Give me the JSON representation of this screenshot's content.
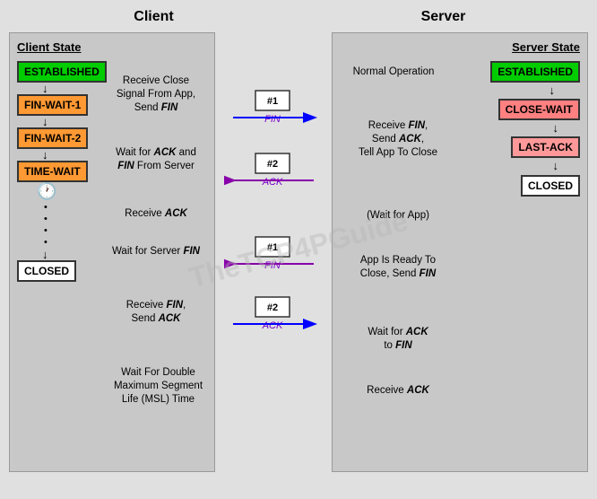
{
  "title": {
    "client": "Client",
    "server": "Server"
  },
  "client": {
    "section_title": "Client State",
    "states": {
      "established": "ESTABLISHED",
      "fin_wait_1": "FIN-WAIT-1",
      "fin_wait_2": "FIN-WAIT-2",
      "time_wait": "TIME-WAIT",
      "closed": "CLOSED"
    },
    "descriptions": {
      "d1": "Receive Close Signal From App, Send FIN",
      "d2": "Wait for ACK and FIN From Server",
      "d3": "Receive ACK",
      "d4": "Wait for Server FIN",
      "d5": "Receive FIN, Send ACK",
      "d6": "Wait For Double Maximum Segment Life (MSL) Time"
    }
  },
  "server": {
    "section_title": "Server State",
    "states": {
      "established": "ESTABLISHED",
      "close_wait": "CLOSE-WAIT",
      "last_ack": "LAST-ACK",
      "closed": "CLOSED"
    },
    "descriptions": {
      "d1": "Normal Operation",
      "d2": "Receive FIN, Send ACK, Tell App To Close",
      "d3": "(Wait for App)",
      "d4": "App Is Ready To Close, Send FIN",
      "d5": "Wait for ACK to FIN",
      "d6": "Receive ACK"
    }
  },
  "arrows": {
    "fin1_label": "#1",
    "fin1_sub": "FIN",
    "ack2_label": "#2",
    "ack2_sub": "ACK",
    "fin3_label": "#1",
    "fin3_sub": "FIN",
    "ack4_label": "#2",
    "ack4_sub": "ACK"
  },
  "watermark": "TheTCP4PGuide"
}
